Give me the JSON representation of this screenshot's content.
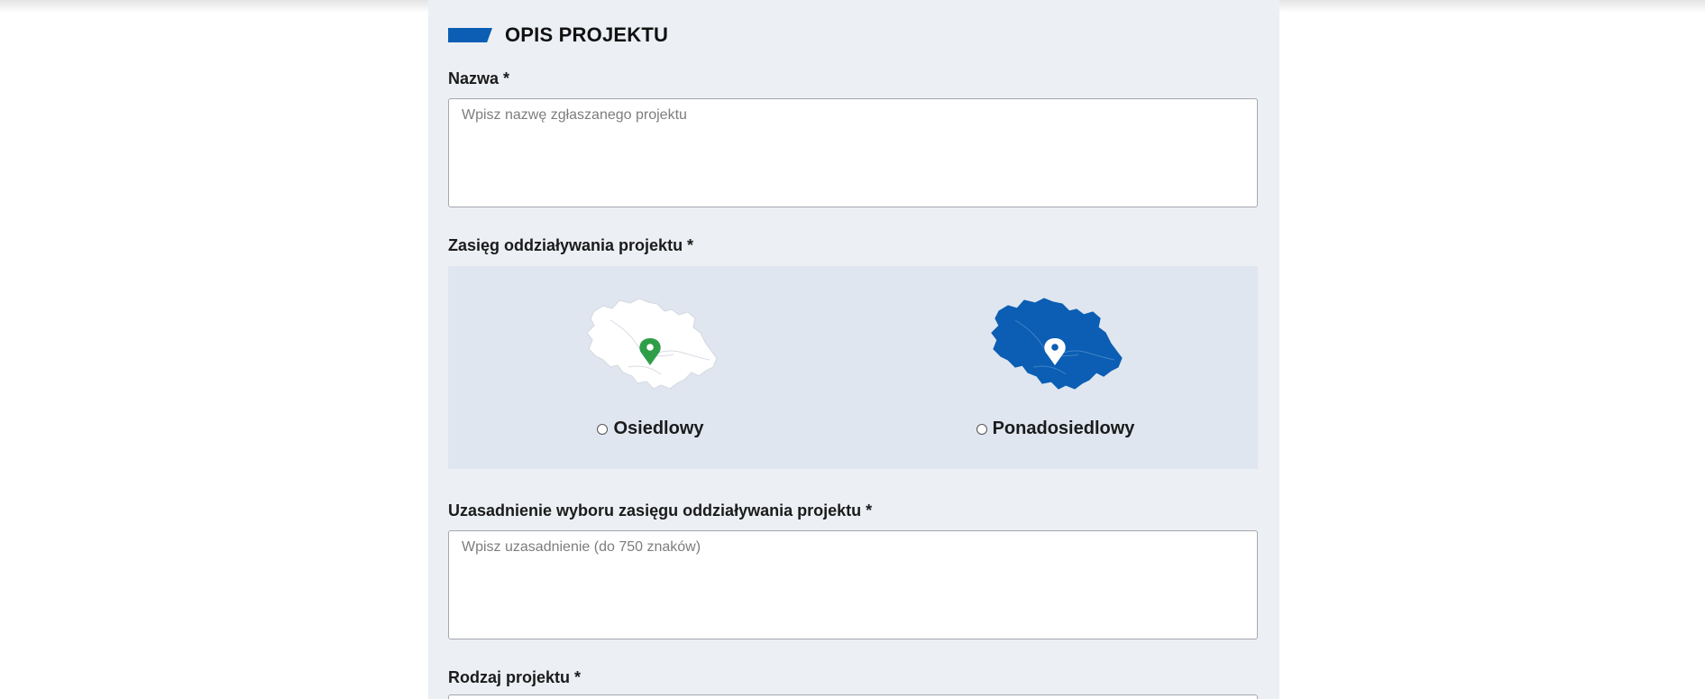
{
  "section": {
    "title": "OPIS PROJEKTU"
  },
  "fields": {
    "name": {
      "label": "Nazwa *",
      "placeholder": "Wpisz nazwę zgłaszanego projektu",
      "value": ""
    },
    "scope": {
      "label": "Zasięg oddziaływania projektu *",
      "options": [
        {
          "label": "Osiedlowy",
          "selected": false,
          "map_color": "#ffffff",
          "pin_color": "#2e9e48"
        },
        {
          "label": "Ponadosiedlowy",
          "selected": false,
          "map_color": "#0b5eb3",
          "pin_color": "#ffffff"
        }
      ]
    },
    "justification": {
      "label": "Uzasadnienie wyboru zasięgu oddziaływania projektu *",
      "placeholder": "Wpisz uzasadnienie (do 750 znaków)",
      "value": ""
    },
    "type": {
      "label": "Rodzaj projektu *"
    }
  },
  "colors": {
    "accent": "#0b5eb3",
    "panel_bg": "#eceff4",
    "scope_bg": "#dfe6f0",
    "pin_green": "#2e9e48"
  }
}
